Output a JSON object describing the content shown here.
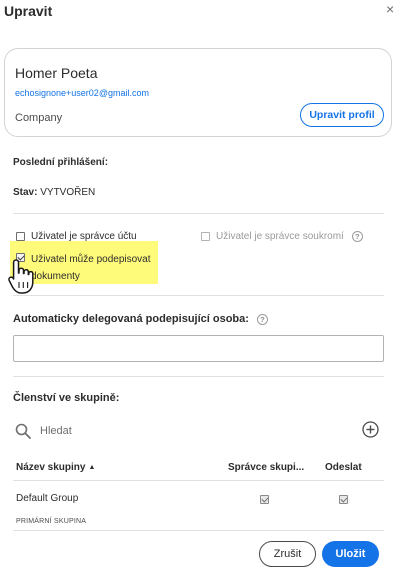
{
  "dialog": {
    "title": "Upravit",
    "close_glyph": "×"
  },
  "user": {
    "name": "Homer Poeta",
    "email": "echosignone+user02@gmail.com",
    "company": "Company",
    "edit_profile_label": "Upravit profil"
  },
  "account": {
    "last_login_label": "Poslední přihlášení:",
    "status_label": "Stav:",
    "status_value": "VYTVOŘEN"
  },
  "permissions": {
    "account_admin_label": "Uživatel je správce účtu",
    "account_admin_checked": false,
    "privacy_admin_label": "Uživatel je správce soukromí",
    "privacy_admin_checked": false,
    "privacy_admin_disabled": true,
    "can_sign_label": "Uživatel může podepisovat dokumenty",
    "can_sign_checked": true,
    "info_glyph": "?"
  },
  "delegation": {
    "label": "Automaticky delegovaná podepisující osoba:",
    "value": "",
    "info_glyph": "?"
  },
  "groups": {
    "label": "Členství ve skupině:",
    "search_placeholder": "Hledat",
    "columns": {
      "name": "Název skupiny",
      "admin": "Správce skupi...",
      "send": "Odeslat"
    },
    "rows": [
      {
        "name": "Default Group",
        "sub_label": "PRIMÁRNÍ SKUPINA",
        "admin_checked": true,
        "send_checked": true
      }
    ]
  },
  "footer": {
    "cancel_label": "Zrušit",
    "save_label": "Uložit"
  },
  "colors": {
    "accent": "#1473e6",
    "highlight": "#fffb7a"
  }
}
